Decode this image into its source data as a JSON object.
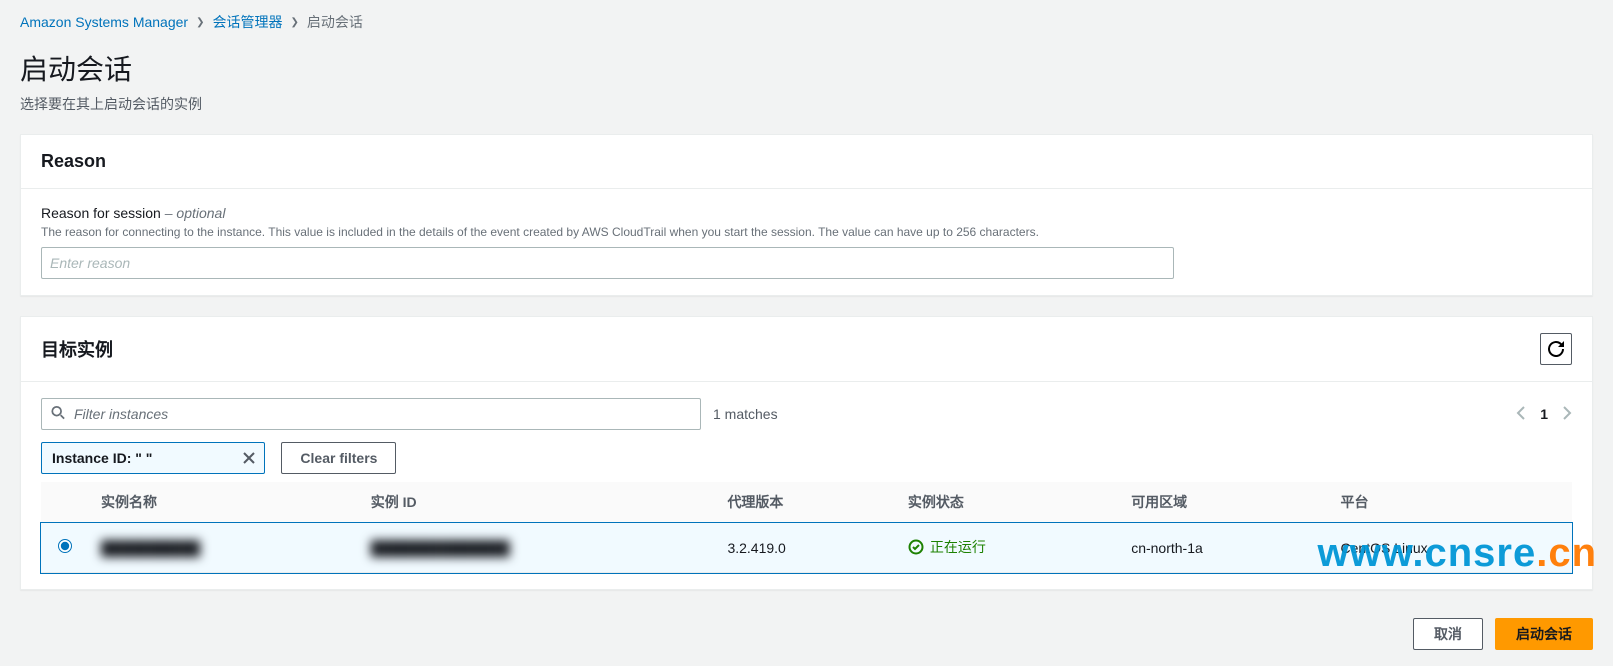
{
  "breadcrumb": {
    "root": "Amazon Systems Manager",
    "mid": "会话管理器",
    "current": "启动会话"
  },
  "header": {
    "title": "启动会话",
    "subtitle": "选择要在其上启动会话的实例"
  },
  "reason_panel": {
    "title": "Reason",
    "label_main": "Reason for session",
    "label_optional": " – optional",
    "description": "The reason for connecting to the instance. This value is included in the details of the event created by AWS CloudTrail when you start the session. The value can have up to 256 characters.",
    "placeholder": "Enter reason"
  },
  "instances_panel": {
    "title": "目标实例",
    "filter_placeholder": "Filter instances",
    "matches_text": "1 matches",
    "page_number": "1",
    "filter_tag_label": "Instance ID: \"                    \"",
    "clear_filters": "Clear filters",
    "columns": {
      "name": "实例名称",
      "id": "实例 ID",
      "agent": "代理版本",
      "status": "实例状态",
      "az": "可用区域",
      "platform": "平台"
    },
    "rows": [
      {
        "name": "██████████",
        "id": "██████████████",
        "agent": "3.2.419.0",
        "status": "正在运行",
        "az": "cn-north-1a",
        "platform": "CentOS Linux",
        "selected": true
      }
    ]
  },
  "footer": {
    "cancel": "取消",
    "start": "启动会话"
  },
  "watermark": {
    "w": "www.",
    "host": "cnsre",
    "tld": ".cn"
  }
}
